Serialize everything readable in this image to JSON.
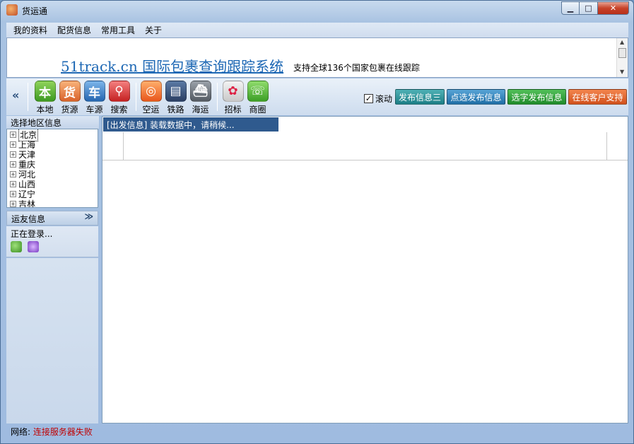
{
  "window": {
    "title": "货运通",
    "controls": {
      "minimize": "▁",
      "maximize": "□",
      "close": "✕"
    }
  },
  "menu": [
    "我的资料",
    "配货信息",
    "常用工具",
    "关于"
  ],
  "banner": {
    "link": "51track.cn 国际包裹查询跟踪系统",
    "desc": "支持全球136个国家包裹在线跟踪"
  },
  "toolbar": {
    "collapse": "«",
    "groups": [
      [
        {
          "glyph": "本",
          "label": "本地",
          "icon": "local-icon"
        },
        {
          "glyph": "货",
          "label": "货源",
          "icon": "cargo-icon"
        },
        {
          "glyph": "车",
          "label": "车源",
          "icon": "truck-icon"
        },
        {
          "glyph": "⚲",
          "label": "搜索",
          "icon": "search-icon"
        }
      ],
      [
        {
          "glyph": "◎",
          "label": "空运",
          "icon": "air-icon"
        },
        {
          "glyph": "▤",
          "label": "铁路",
          "icon": "train-icon"
        },
        {
          "glyph": "⛴",
          "label": "海运",
          "icon": "ship-icon"
        }
      ],
      [
        {
          "glyph": "✿",
          "label": "招标",
          "icon": "bid-icon"
        },
        {
          "glyph": "☏",
          "label": "商圈",
          "icon": "chat-icon"
        }
      ]
    ],
    "scroll_label": "滚动",
    "scroll_checked": "✓",
    "buttons": [
      "发布信息三",
      "点选发布信息",
      "选字发布信息",
      "在线客户支持"
    ]
  },
  "left": {
    "region_title": "选择地区信息",
    "regions": [
      "北京",
      "上海",
      "天津",
      "重庆",
      "河北",
      "山西",
      "辽宁",
      "吉林"
    ],
    "friends_title": "运友信息",
    "friends_toggle": "≫",
    "login_status": "正在登录..."
  },
  "main": {
    "loading": "[出发信息] 装载数据中，请稍候..."
  },
  "status": {
    "label": "网络:",
    "value": "连接服务器失败"
  }
}
